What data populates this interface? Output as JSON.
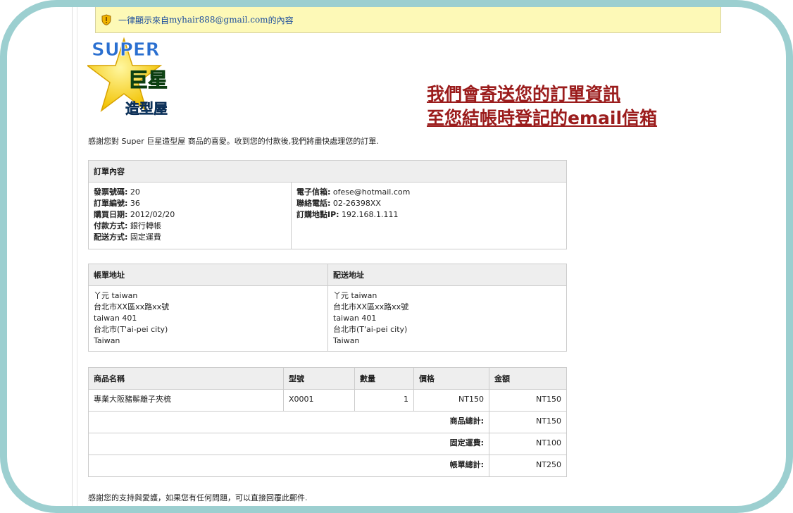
{
  "notice": {
    "prefix": "一律顯示來自 ",
    "email": "myhair888@gmail.com",
    "suffix": " 的內容"
  },
  "logo": {
    "top": "SUPER",
    "mid": "巨星",
    "bottom": "造型屋"
  },
  "promo": {
    "line1": "我們會寄送您的訂單資訊",
    "line2": "至您結帳時登記的email信箱"
  },
  "intro": "感謝您對 Super 巨星造型屋 商品的喜愛。收到您的付款後,我們將盡快處理您的訂單.",
  "order": {
    "header": "訂單內容",
    "left": [
      {
        "label": "發票號碼:",
        "value": " 20"
      },
      {
        "label": "訂單編號:",
        "value": " 36"
      },
      {
        "label": "購買日期:",
        "value": " 2012/02/20"
      },
      {
        "label": "付款方式:",
        "value": " 銀行轉帳"
      },
      {
        "label": "配送方式:",
        "value": " 固定運費"
      }
    ],
    "right": [
      {
        "label": "電子信箱:",
        "value": " ofese@hotmail.com"
      },
      {
        "label": "聯絡電話:",
        "value": " 02-26398XX"
      },
      {
        "label": "訂購地點IP:",
        "value": " 192.168.1.111"
      }
    ]
  },
  "address": {
    "billing_header": "帳單地址",
    "shipping_header": "配送地址",
    "billing": [
      "丫元 taiwan",
      "台北市XX區xx路xx號",
      "taiwan 401",
      "台北市(T'ai-pei city)",
      "Taiwan"
    ],
    "shipping": [
      "丫元 taiwan",
      "台北市XX區xx路xx號",
      "taiwan 401",
      "台北市(T'ai-pei city)",
      "Taiwan"
    ]
  },
  "items": {
    "headers": {
      "name": "商品名稱",
      "model": "型號",
      "qty": "數量",
      "price": "價格",
      "amount": "金額"
    },
    "rows": [
      {
        "name": "專業大阪豬鬃離子夾梳",
        "model": "X0001",
        "qty": "1",
        "price": "NT150",
        "amount": "NT150"
      }
    ],
    "subtotal_label": "商品總計:",
    "subtotal": "NT150",
    "shipping_label": "固定運費:",
    "shipping": "NT100",
    "total_label": "帳單總計:",
    "total": "NT250"
  },
  "closing": "感謝您的支持與愛護，如果您有任何問題，可以直接回覆此郵件.",
  "colors": {
    "frame": "#9ccfd0",
    "notice_bg": "#fdf9b7",
    "promo": "#9b1c1c",
    "link": "#1a4c9c"
  }
}
